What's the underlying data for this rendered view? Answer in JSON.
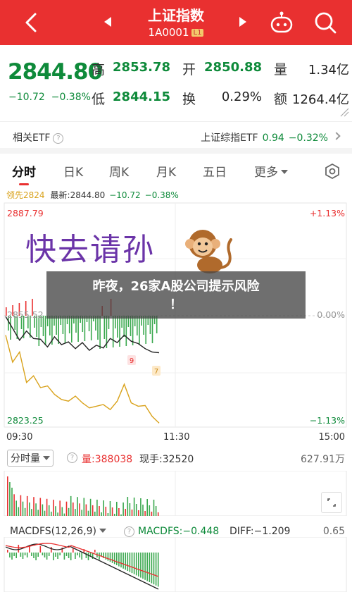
{
  "header": {
    "title": "上证指数",
    "code": "1A0001",
    "level": "L1"
  },
  "quote": {
    "price": "2844.80",
    "change": "−10.72",
    "change_pct": "−0.38%",
    "high_label": "高",
    "high": "2853.78",
    "open_label": "开",
    "open": "2850.88",
    "volume_label": "量",
    "volume": "1.34亿",
    "low_label": "低",
    "low": "2844.15",
    "turnover_label": "换",
    "turnover": "0.29%",
    "amount_label": "额",
    "amount": "1264.4亿"
  },
  "etf": {
    "label": "相关ETF",
    "name": "上证综指ETF",
    "price": "0.94",
    "change_pct": "−0.32%"
  },
  "tabs": [
    {
      "label": "分时",
      "active": true
    },
    {
      "label": "日K"
    },
    {
      "label": "周K"
    },
    {
      "label": "月K"
    },
    {
      "label": "五日"
    },
    {
      "label": "更多"
    }
  ],
  "legend": {
    "lead_label": "领先2824",
    "latest": "最新:2844.80",
    "change": "−10.72",
    "change_pct": "−0.38%"
  },
  "chart_data": {
    "type": "line",
    "y_top": "2887.79",
    "y_mid": "2855.52",
    "y_bottom": "2823.25",
    "pct_top": "+1.13%",
    "pct_mid": "0.00%",
    "pct_bottom": "−1.13%",
    "time_labels": [
      "09:30",
      "11:30",
      "15:00"
    ],
    "ylim": [
      2823.25,
      2887.79
    ],
    "series": [
      {
        "values": [
          2855.5,
          2852.0,
          2848.5,
          2851.2,
          2849.0,
          2848.8,
          2846.5,
          2849.5,
          2847.2,
          2848.0,
          2846.0,
          2847.8,
          2845.5,
          2847.0,
          2846.2,
          2849.0,
          2847.8,
          2850.0,
          2848.2,
          2847.5,
          2846.0,
          2845.0,
          2844.8
        ],
        "color": "#222222"
      },
      {
        "values": [
          2850.0,
          2842.0,
          2845.0,
          2836.0,
          2838.0,
          2834.5,
          2835.0,
          2832.5,
          2831.0,
          2830.5,
          2832.0,
          2830.0,
          2828.5,
          2829.0,
          2829.5,
          2828.0,
          2830.5,
          2835.5,
          2830.0,
          2829.0,
          2829.2,
          2826.0,
          2824.0
        ],
        "color": "#d9a21b"
      }
    ],
    "markers": [
      "9",
      "7"
    ]
  },
  "volume": {
    "label": "分时量",
    "value_label": "量:388038",
    "now_label": "现手:32520",
    "max": "627.91万"
  },
  "macd": {
    "label": "MACDFS(12,26,9)",
    "macd": "MACDFS:−0.448",
    "diff": "DIFF:−1.209",
    "max": "0.65"
  },
  "watermark": "快去请孙",
  "news": {
    "line1": "昨夜，26家A股公司提示风险",
    "line2": "！"
  },
  "colors": {
    "brand": "#e93030",
    "down": "#0e8a3a",
    "avg_line": "#d9a21b"
  }
}
